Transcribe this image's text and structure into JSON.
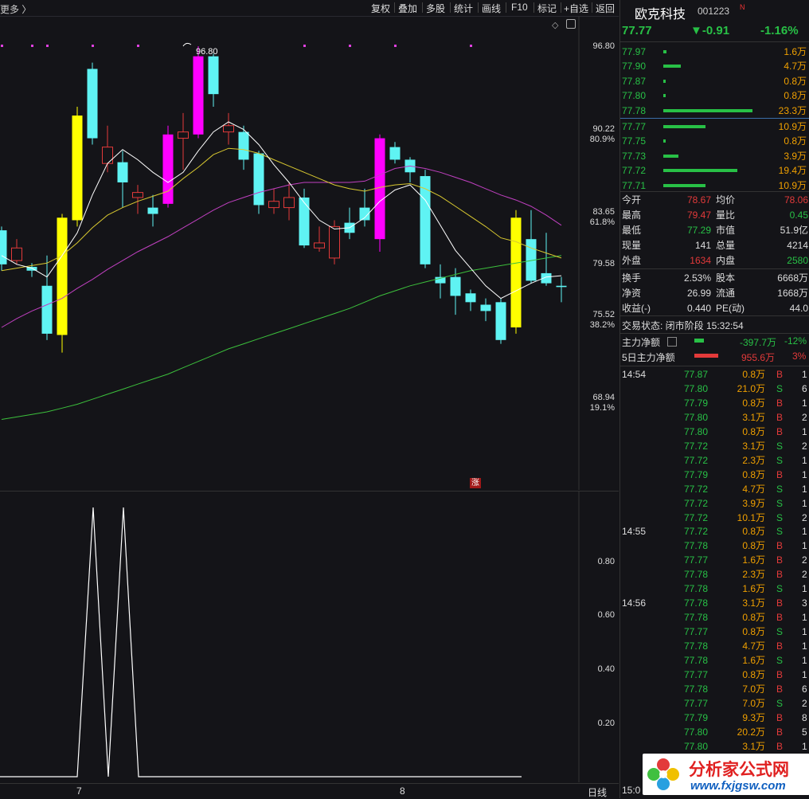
{
  "toolbar": {
    "more_label": "更多 〉",
    "buttons": [
      "复权",
      "叠加",
      "多股",
      "统计",
      "画线",
      "F10",
      "标记",
      "+自选",
      "返回"
    ]
  },
  "stock": {
    "name": "欧克科技",
    "code": "001223",
    "flag": "N",
    "price": "77.77",
    "change": "▼-0.91",
    "change_pct": "-1.16%"
  },
  "asks": [
    {
      "price": "77.97",
      "vol": "1.6万",
      "level": 0.04
    },
    {
      "price": "77.90",
      "vol": "4.7万",
      "level": 0.2
    },
    {
      "price": "77.87",
      "vol": "0.8万",
      "level": 0.03
    },
    {
      "price": "77.80",
      "vol": "0.8万",
      "level": 0.03
    },
    {
      "price": "77.78",
      "vol": "23.3万",
      "level": 1.0
    }
  ],
  "bids": [
    {
      "price": "77.77",
      "vol": "10.9万",
      "level": 0.47
    },
    {
      "price": "77.75",
      "vol": "0.8万",
      "level": 0.03
    },
    {
      "price": "77.73",
      "vol": "3.9万",
      "level": 0.17
    },
    {
      "price": "77.72",
      "vol": "19.4万",
      "level": 0.83
    },
    {
      "price": "77.71",
      "vol": "10.9万",
      "level": 0.47
    }
  ],
  "stats": [
    {
      "l1": "今开",
      "v1": "78.67",
      "c1": "r",
      "l2": "均价",
      "v2": "78.06",
      "c2": "r"
    },
    {
      "l1": "最高",
      "v1": "79.47",
      "c1": "r",
      "l2": "量比",
      "v2": "0.45",
      "c2": "g"
    },
    {
      "l1": "最低",
      "v1": "77.29",
      "c1": "g",
      "l2": "市值",
      "v2": "51.9亿",
      "c2": "w"
    },
    {
      "l1": "现量",
      "v1": "141",
      "c1": "w",
      "l2": "总量",
      "v2": "4214",
      "c2": "w"
    },
    {
      "l1": "外盘",
      "v1": "1634",
      "c1": "r",
      "l2": "内盘",
      "v2": "2580",
      "c2": "g"
    }
  ],
  "stats2": [
    {
      "l1": "换手",
      "v1": "2.53%",
      "l2": "股本",
      "v2": "6668万"
    },
    {
      "l1": "净资",
      "v1": "26.99",
      "l2": "流通",
      "v2": "1668万"
    },
    {
      "l1": "收益(-)",
      "v1": "0.440",
      "l2": "PE(动)",
      "v2": "44.0"
    }
  ],
  "trade_status": "交易状态: 闭市阶段 15:32:54",
  "main_net": {
    "label": "主力净额",
    "value": "-397.7万",
    "pct": "-12%"
  },
  "net5": {
    "label": "5日主力净额",
    "value": "955.6万",
    "pct": "3%"
  },
  "ticks": [
    {
      "time": "14:54",
      "price": "77.87",
      "vol": "0.8万",
      "side": "B",
      "n": "1"
    },
    {
      "time": "",
      "price": "77.80",
      "vol": "21.0万",
      "side": "S",
      "n": "6"
    },
    {
      "time": "",
      "price": "77.79",
      "vol": "0.8万",
      "side": "B",
      "n": "1"
    },
    {
      "time": "",
      "price": "77.80",
      "vol": "3.1万",
      "side": "B",
      "n": "2"
    },
    {
      "time": "",
      "price": "77.80",
      "vol": "0.8万",
      "side": "B",
      "n": "1"
    },
    {
      "time": "",
      "price": "77.72",
      "vol": "3.1万",
      "side": "S",
      "n": "2"
    },
    {
      "time": "",
      "price": "77.72",
      "vol": "2.3万",
      "side": "S",
      "n": "1"
    },
    {
      "time": "",
      "price": "77.79",
      "vol": "0.8万",
      "side": "B",
      "n": "1"
    },
    {
      "time": "",
      "price": "77.72",
      "vol": "4.7万",
      "side": "S",
      "n": "1"
    },
    {
      "time": "",
      "price": "77.72",
      "vol": "3.9万",
      "side": "S",
      "n": "1"
    },
    {
      "time": "",
      "price": "77.72",
      "vol": "10.1万",
      "side": "S",
      "n": "2"
    },
    {
      "time": "14:55",
      "price": "77.72",
      "vol": "0.8万",
      "side": "S",
      "n": "1"
    },
    {
      "time": "",
      "price": "77.78",
      "vol": "0.8万",
      "side": "B",
      "n": "1"
    },
    {
      "time": "",
      "price": "77.77",
      "vol": "1.6万",
      "side": "B",
      "n": "2"
    },
    {
      "time": "",
      "price": "77.78",
      "vol": "2.3万",
      "side": "B",
      "n": "2"
    },
    {
      "time": "",
      "price": "77.78",
      "vol": "1.6万",
      "side": "S",
      "n": "1"
    },
    {
      "time": "14:56",
      "price": "77.78",
      "vol": "3.1万",
      "side": "B",
      "n": "3"
    },
    {
      "time": "",
      "price": "77.78",
      "vol": "0.8万",
      "side": "B",
      "n": "1"
    },
    {
      "time": "",
      "price": "77.77",
      "vol": "0.8万",
      "side": "S",
      "n": "1"
    },
    {
      "time": "",
      "price": "77.78",
      "vol": "4.7万",
      "side": "B",
      "n": "1"
    },
    {
      "time": "",
      "price": "77.78",
      "vol": "1.6万",
      "side": "S",
      "n": "1"
    },
    {
      "time": "",
      "price": "77.77",
      "vol": "0.8万",
      "side": "B",
      "n": "1"
    },
    {
      "time": "",
      "price": "77.78",
      "vol": "7.0万",
      "side": "B",
      "n": "6"
    },
    {
      "time": "",
      "price": "77.77",
      "vol": "7.0万",
      "side": "S",
      "n": "2"
    },
    {
      "time": "",
      "price": "77.79",
      "vol": "9.3万",
      "side": "B",
      "n": "8"
    },
    {
      "time": "",
      "price": "77.80",
      "vol": "20.2万",
      "side": "B",
      "n": "5"
    },
    {
      "time": "",
      "price": "77.80",
      "vol": "3.1万",
      "side": "B",
      "n": "1"
    }
  ],
  "ticks_footer_time": "15:0",
  "chart": {
    "price_labels": [
      {
        "v": "96.80",
        "pct": ""
      },
      {
        "v": "90.22",
        "pct": "80.9%"
      },
      {
        "v": "83.65",
        "pct": "61.8%"
      },
      {
        "v": "79.58",
        "pct": ""
      },
      {
        "v": "75.52",
        "pct": "38.2%"
      },
      {
        "v": "68.94",
        "pct": "19.1%"
      }
    ],
    "high_marker": "96.80",
    "zhang_label": "涨",
    "sub_labels": [
      "0.80",
      "0.60",
      "0.40",
      "0.20"
    ],
    "x_labels": [
      "7",
      "8"
    ],
    "period_label": "日线"
  },
  "watermark": {
    "text": "分析家公式网",
    "url": "www.fxjgsw.com"
  },
  "chart_data": {
    "type": "candlestick",
    "price_range": [
      63.0,
      100.0
    ],
    "candles": [
      {
        "o": 79.5,
        "c": 82.2,
        "h": 82.5,
        "l": 79.0,
        "col": "cyan"
      },
      {
        "o": 79.8,
        "c": 80.8,
        "h": 81.5,
        "l": 79.5,
        "col": "red"
      },
      {
        "o": 79.3,
        "c": 79.0,
        "h": 79.6,
        "l": 78.5,
        "col": "cyan"
      },
      {
        "o": 77.8,
        "c": 74.0,
        "h": 80.2,
        "l": 73.5,
        "col": "cyan"
      },
      {
        "o": 73.9,
        "c": 83.2,
        "h": 83.5,
        "l": 72.5,
        "col": "yellow"
      },
      {
        "o": 83.0,
        "c": 91.3,
        "h": 92.0,
        "l": 82.5,
        "col": "yellow"
      },
      {
        "o": 89.5,
        "c": 95.0,
        "h": 95.5,
        "l": 89.0,
        "col": "cyan"
      },
      {
        "o": 87.5,
        "c": 88.8,
        "h": 90.5,
        "l": 86.8,
        "col": "red"
      },
      {
        "o": 87.6,
        "c": 86.0,
        "h": 88.5,
        "l": 84.0,
        "col": "cyan"
      },
      {
        "o": 84.8,
        "c": 85.2,
        "h": 85.8,
        "l": 83.5,
        "col": "red"
      },
      {
        "o": 84.0,
        "c": 83.5,
        "h": 85.0,
        "l": 82.5,
        "col": "cyan"
      },
      {
        "o": 84.3,
        "c": 89.8,
        "h": 90.5,
        "l": 84.0,
        "col": "magenta"
      },
      {
        "o": 89.5,
        "c": 90.0,
        "h": 91.5,
        "l": 87.0,
        "col": "red"
      },
      {
        "o": 89.8,
        "c": 96.0,
        "h": 96.8,
        "l": 89.5,
        "col": "magenta"
      },
      {
        "o": 96.0,
        "c": 93.0,
        "h": 96.2,
        "l": 92.0,
        "col": "cyan"
      },
      {
        "o": 90.0,
        "c": 90.5,
        "h": 91.5,
        "l": 89.0,
        "col": "red"
      },
      {
        "o": 90.0,
        "c": 87.8,
        "h": 90.5,
        "l": 87.0,
        "col": "cyan"
      },
      {
        "o": 88.3,
        "c": 84.2,
        "h": 88.5,
        "l": 83.5,
        "col": "cyan"
      },
      {
        "o": 84.0,
        "c": 84.5,
        "h": 85.5,
        "l": 83.5,
        "col": "red"
      },
      {
        "o": 84.0,
        "c": 84.8,
        "h": 86.0,
        "l": 83.0,
        "col": "red"
      },
      {
        "o": 84.8,
        "c": 81.0,
        "h": 85.5,
        "l": 80.8,
        "col": "cyan"
      },
      {
        "o": 80.8,
        "c": 81.2,
        "h": 82.5,
        "l": 80.5,
        "col": "red"
      },
      {
        "o": 80.0,
        "c": 82.5,
        "h": 83.0,
        "l": 79.5,
        "col": "red"
      },
      {
        "o": 82.8,
        "c": 82.0,
        "h": 84.0,
        "l": 81.5,
        "col": "cyan"
      },
      {
        "o": 83.0,
        "c": 84.0,
        "h": 85.5,
        "l": 82.5,
        "col": "cyan"
      },
      {
        "o": 81.5,
        "c": 89.5,
        "h": 89.8,
        "l": 80.5,
        "col": "magenta"
      },
      {
        "o": 88.8,
        "c": 87.8,
        "h": 89.2,
        "l": 87.5,
        "col": "cyan"
      },
      {
        "o": 87.8,
        "c": 86.8,
        "h": 88.0,
        "l": 86.0,
        "col": "cyan"
      },
      {
        "o": 86.5,
        "c": 79.5,
        "h": 87.0,
        "l": 79.2,
        "col": "cyan"
      },
      {
        "o": 78.5,
        "c": 78.0,
        "h": 79.5,
        "l": 76.8,
        "col": "cyan"
      },
      {
        "o": 78.5,
        "c": 77.0,
        "h": 79.2,
        "l": 75.5,
        "col": "cyan"
      },
      {
        "o": 77.2,
        "c": 76.5,
        "h": 77.5,
        "l": 75.8,
        "col": "cyan"
      },
      {
        "o": 76.3,
        "c": 75.8,
        "h": 76.8,
        "l": 75.0,
        "col": "cyan"
      },
      {
        "o": 76.5,
        "c": 73.5,
        "h": 76.8,
        "l": 73.2,
        "col": "cyan"
      },
      {
        "o": 74.5,
        "c": 83.2,
        "h": 83.8,
        "l": 74.0,
        "col": "yellow"
      },
      {
        "o": 81.5,
        "c": 78.2,
        "h": 83.8,
        "l": 78.0,
        "col": "cyan"
      },
      {
        "o": 78.8,
        "c": 78.0,
        "h": 82.0,
        "l": 77.8,
        "col": "cyan"
      },
      {
        "o": 77.8,
        "c": 77.7,
        "h": 78.5,
        "l": 76.5,
        "col": "cyan"
      }
    ],
    "ma_white": [
      80.2,
      79.5,
      79.2,
      78.5,
      80.2,
      82.0,
      85.0,
      87.5,
      88.6,
      87.8,
      86.8,
      86.0,
      86.8,
      88.5,
      90.0,
      90.8,
      90.2,
      89.0,
      87.4,
      86.0,
      84.4,
      83.0,
      82.3,
      82.4,
      83.2,
      84.5,
      85.4,
      85.8,
      84.6,
      82.6,
      80.6,
      79.2,
      77.8,
      76.8,
      77.4,
      78.0,
      78.5,
      78.6
    ],
    "ma_yellow": [
      79.0,
      79.2,
      79.4,
      79.6,
      80.2,
      81.2,
      82.4,
      83.4,
      84.0,
      84.5,
      84.9,
      85.3,
      86.3,
      87.2,
      88.2,
      88.7,
      88.6,
      88.3,
      87.8,
      87.3,
      86.8,
      86.3,
      85.8,
      85.5,
      85.3,
      85.6,
      85.8,
      85.9,
      85.5,
      84.9,
      84.1,
      83.3,
      82.5,
      81.6,
      81.3,
      80.8,
      80.4,
      80.0
    ],
    "ma_magenta": [
      74.5,
      75.2,
      75.8,
      76.3,
      76.8,
      77.6,
      78.3,
      79.1,
      79.8,
      80.5,
      81.1,
      81.7,
      82.4,
      83.1,
      83.8,
      84.4,
      84.8,
      85.2,
      85.5,
      85.8,
      86.0,
      86.0,
      86.0,
      86.0,
      86.1,
      86.6,
      87.1,
      87.3,
      87.1,
      86.8,
      86.4,
      86.0,
      85.5,
      85.0,
      84.6,
      84.1,
      83.4,
      82.6
    ],
    "ma_green": [
      67.2,
      67.4,
      67.6,
      67.8,
      68.1,
      68.4,
      68.8,
      69.2,
      69.6,
      70.0,
      70.4,
      70.8,
      71.3,
      71.8,
      72.3,
      72.8,
      73.2,
      73.6,
      74.0,
      74.4,
      74.8,
      75.2,
      75.6,
      76.0,
      76.5,
      77.0,
      77.4,
      77.8,
      78.1,
      78.4,
      78.7,
      79.0,
      79.2,
      79.4,
      79.6,
      79.8,
      80.0,
      80.2
    ],
    "sub_series": [
      0,
      0,
      0,
      0,
      0,
      1,
      0,
      1,
      0,
      0,
      0,
      0,
      0,
      0,
      0,
      0,
      0,
      0,
      0,
      0,
      0,
      0,
      0,
      0,
      0,
      0,
      0,
      0,
      0,
      0,
      0,
      0,
      0,
      0,
      0,
      0,
      0,
      0
    ],
    "sub_range": [
      0,
      1
    ]
  }
}
